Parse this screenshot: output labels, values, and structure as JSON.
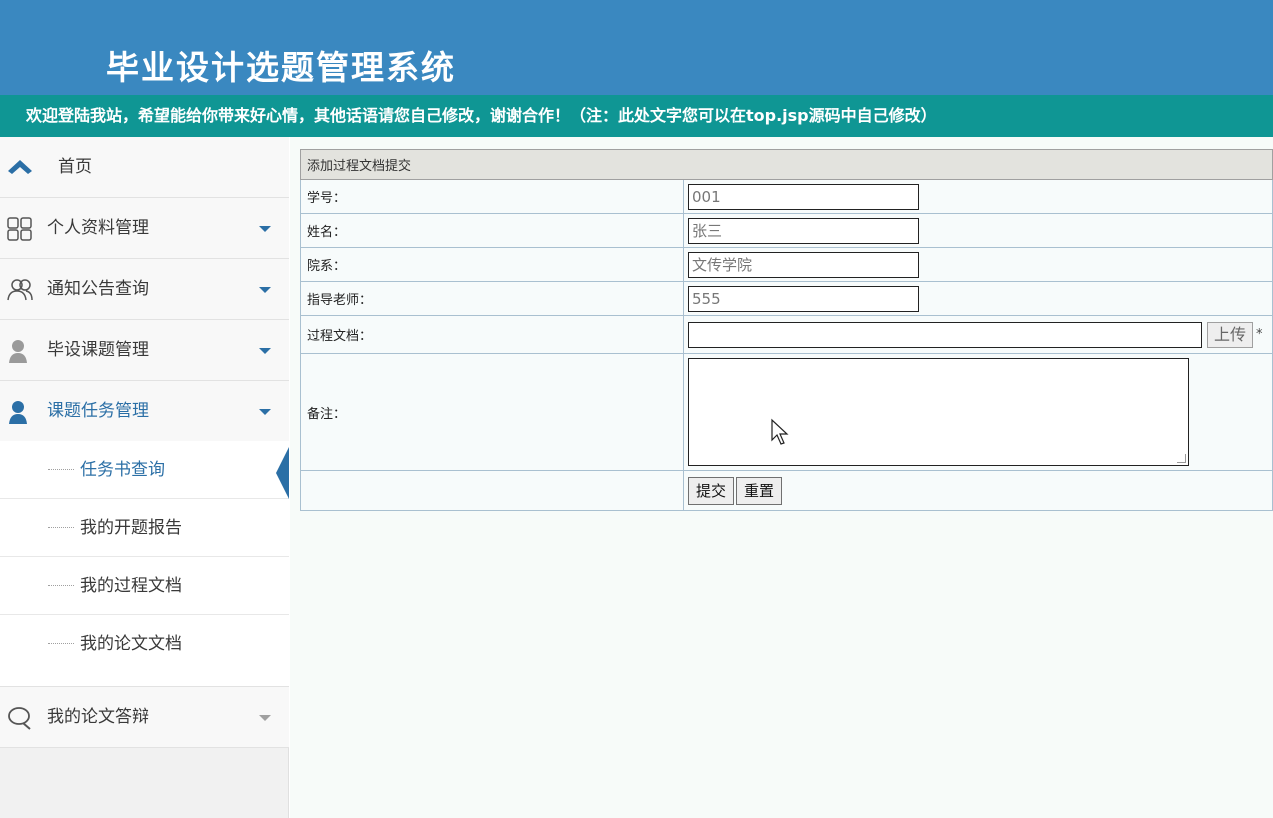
{
  "header": {
    "title": "毕业设计选题管理系统",
    "notice": "欢迎登陆我站，希望能给你带来好心情，其他话语请您自己修改，谢谢合作！（注：此处文字您可以在top.jsp源码中自己修改）"
  },
  "sidebar": {
    "items": [
      {
        "label": "首页",
        "icon": "home-icon"
      },
      {
        "label": "个人资料管理",
        "icon": "grid-icon"
      },
      {
        "label": "通知公告查询",
        "icon": "users-icon"
      },
      {
        "label": "毕设课题管理",
        "icon": "user-icon"
      },
      {
        "label": "课题任务管理",
        "icon": "user-icon"
      },
      {
        "label": "我的论文答辩",
        "icon": "chat-icon"
      }
    ],
    "submenu": [
      {
        "label": "任务书查询"
      },
      {
        "label": "我的开题报告"
      },
      {
        "label": "我的过程文档"
      },
      {
        "label": "我的论文文档"
      }
    ]
  },
  "form": {
    "caption": "添加过程文档提交",
    "student_id_label": "学号：",
    "student_id_value": "001",
    "name_label": "姓名：",
    "name_value": "张三",
    "department_label": "院系：",
    "department_value": "文传学院",
    "advisor_label": "指导老师：",
    "advisor_value": "555",
    "document_label": "过程文档：",
    "upload_label": "上传",
    "required_mark": "*",
    "remark_label": "备注：",
    "submit_label": "提交",
    "reset_label": "重置"
  },
  "colors": {
    "header_bg": "#3a88c0",
    "notice_bg": "#0f9694",
    "accent": "#2b6fa6"
  }
}
